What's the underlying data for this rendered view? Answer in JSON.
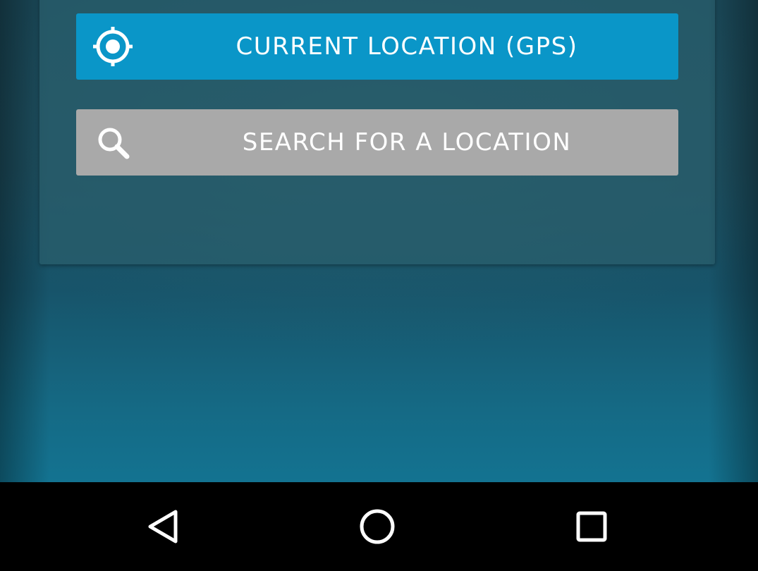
{
  "location_dialog": {
    "gps_button": {
      "label": "CURRENT LOCATION (GPS)",
      "icon": "gps-target-icon",
      "color": "#0a96c8"
    },
    "search_button": {
      "label": "SEARCH FOR A LOCATION",
      "icon": "search-icon",
      "color": "#a9a9a9"
    }
  },
  "navigation_bar": {
    "buttons": [
      {
        "name": "back",
        "icon": "back-triangle-icon"
      },
      {
        "name": "home",
        "icon": "home-circle-icon"
      },
      {
        "name": "recents",
        "icon": "recents-square-icon"
      }
    ]
  },
  "colors": {
    "background_top": "#1b4a5a",
    "background_bottom": "#137391",
    "navbar": "#000000"
  }
}
